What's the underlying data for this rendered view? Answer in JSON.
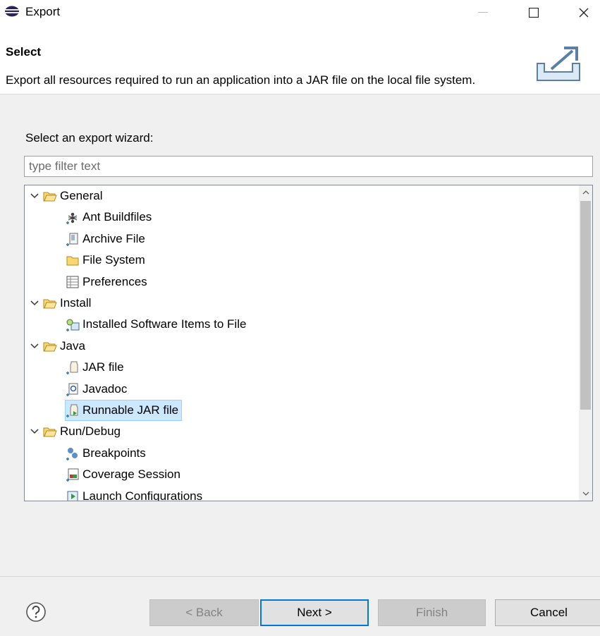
{
  "window": {
    "title": "Export",
    "minimize_icon": "minimize-icon",
    "maximize_icon": "maximize-icon",
    "close_icon": "close-icon"
  },
  "header": {
    "title": "Select",
    "description": "Export all resources required to run an application into a JAR file on the local file system.",
    "icon": "export-wizard-icon"
  },
  "wizard": {
    "label": "Select an export wizard:",
    "filter_placeholder": "type filter text",
    "filter_value": ""
  },
  "tree": {
    "items": [
      {
        "label": "General",
        "type": "folder",
        "expanded": true
      },
      {
        "label": "Ant Buildfiles",
        "icon": "ant-icon"
      },
      {
        "label": "Archive File",
        "icon": "archive-icon"
      },
      {
        "label": "File System",
        "icon": "folder-icon"
      },
      {
        "label": "Preferences",
        "icon": "preferences-icon"
      },
      {
        "label": "Install",
        "type": "folder",
        "expanded": true
      },
      {
        "label": "Installed Software Items to File",
        "icon": "installed-software-icon"
      },
      {
        "label": "Java",
        "type": "folder",
        "expanded": true
      },
      {
        "label": "JAR file",
        "icon": "jar-icon"
      },
      {
        "label": "Javadoc",
        "icon": "javadoc-icon"
      },
      {
        "label": "Runnable JAR file",
        "icon": "runnable-jar-icon",
        "selected": true
      },
      {
        "label": "Run/Debug",
        "type": "folder",
        "expanded": true
      },
      {
        "label": "Breakpoints",
        "icon": "breakpoints-icon"
      },
      {
        "label": "Coverage Session",
        "icon": "coverage-icon"
      },
      {
        "label": "Launch Configurations",
        "icon": "launch-config-icon"
      }
    ]
  },
  "buttons": {
    "back": "< Back",
    "next": "Next >",
    "finish": "Finish",
    "cancel": "Cancel",
    "help_icon": "help-icon"
  },
  "colors": {
    "accent": "#0078d7",
    "selection": "#cce8ff",
    "folder": "#f5c542"
  }
}
